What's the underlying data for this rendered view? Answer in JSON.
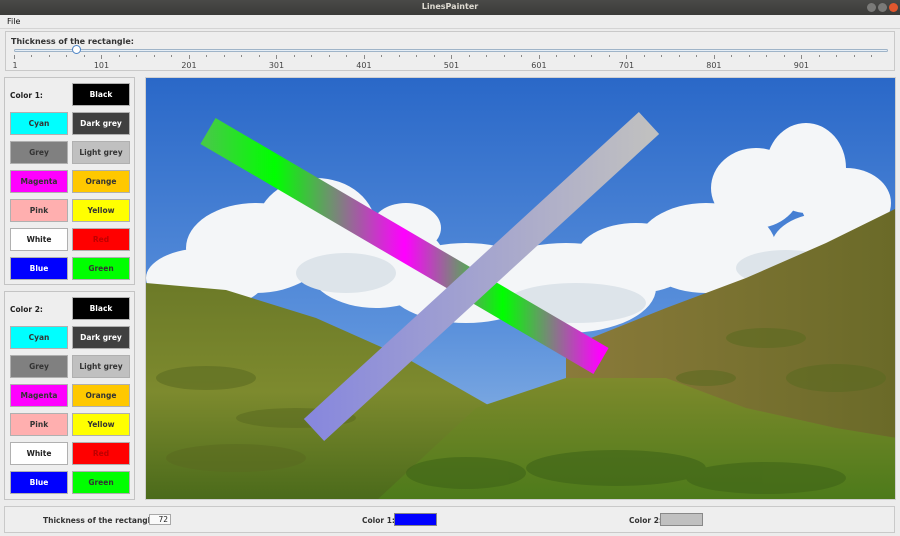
{
  "window": {
    "title": "LinesPainter"
  },
  "menu": {
    "file": "File"
  },
  "slider": {
    "label": "Thickness of the rectangle:",
    "min": 1,
    "max": 1000,
    "value": 72,
    "tick_labels": [
      "1",
      "101",
      "201",
      "301",
      "401",
      "501",
      "601",
      "701",
      "801",
      "901"
    ]
  },
  "color1": {
    "label": "Color 1:",
    "buttons": [
      {
        "label": "Black",
        "bg": "#000000",
        "fg": "#ffffff"
      },
      {
        "label": "Cyan",
        "bg": "#00ffff",
        "fg": "#333333"
      },
      {
        "label": "Dark grey",
        "bg": "#404040",
        "fg": "#ffffff"
      },
      {
        "label": "Grey",
        "bg": "#808080",
        "fg": "#333333"
      },
      {
        "label": "Light grey",
        "bg": "#c0c0c0",
        "fg": "#333333"
      },
      {
        "label": "Magenta",
        "bg": "#ff00ff",
        "fg": "#333333"
      },
      {
        "label": "Orange",
        "bg": "#ffc800",
        "fg": "#333333"
      },
      {
        "label": "Pink",
        "bg": "#ffafaf",
        "fg": "#333333"
      },
      {
        "label": "Yellow",
        "bg": "#ffff00",
        "fg": "#333333"
      },
      {
        "label": "White",
        "bg": "#ffffff",
        "fg": "#222222"
      },
      {
        "label": "Red",
        "bg": "#ff0000",
        "fg": "#c00000"
      },
      {
        "label": "Blue",
        "bg": "#0000ff",
        "fg": "#ffffff"
      },
      {
        "label": "Green",
        "bg": "#00ff00",
        "fg": "#333333"
      }
    ]
  },
  "color2": {
    "label": "Color 2:",
    "buttons": [
      {
        "label": "Black",
        "bg": "#000000",
        "fg": "#ffffff"
      },
      {
        "label": "Cyan",
        "bg": "#00ffff",
        "fg": "#333333"
      },
      {
        "label": "Dark grey",
        "bg": "#404040",
        "fg": "#ffffff"
      },
      {
        "label": "Grey",
        "bg": "#808080",
        "fg": "#333333"
      },
      {
        "label": "Light grey",
        "bg": "#c0c0c0",
        "fg": "#333333"
      },
      {
        "label": "Magenta",
        "bg": "#ff00ff",
        "fg": "#333333"
      },
      {
        "label": "Orange",
        "bg": "#ffc800",
        "fg": "#333333"
      },
      {
        "label": "Pink",
        "bg": "#ffafaf",
        "fg": "#333333"
      },
      {
        "label": "Yellow",
        "bg": "#ffff00",
        "fg": "#333333"
      },
      {
        "label": "White",
        "bg": "#ffffff",
        "fg": "#222222"
      },
      {
        "label": "Red",
        "bg": "#ff0000",
        "fg": "#c00000"
      },
      {
        "label": "Blue",
        "bg": "#0000ff",
        "fg": "#ffffff"
      },
      {
        "label": "Green",
        "bg": "#00ff00",
        "fg": "#333333"
      }
    ]
  },
  "status": {
    "thickness_label": "Thickness of the rectangle:",
    "thickness_value": "72",
    "color1_label": "Color 1:",
    "color1_value": "#0000ff",
    "color2_label": "Color 2:",
    "color2_value": "#c0c0c0"
  },
  "canvas": {
    "stroke1": {
      "from": "#00ff00",
      "mid": "#ff00ff",
      "to": "#00ff00"
    },
    "stroke2": {
      "from": "#8888dd",
      "to": "#c0c0c0"
    }
  }
}
